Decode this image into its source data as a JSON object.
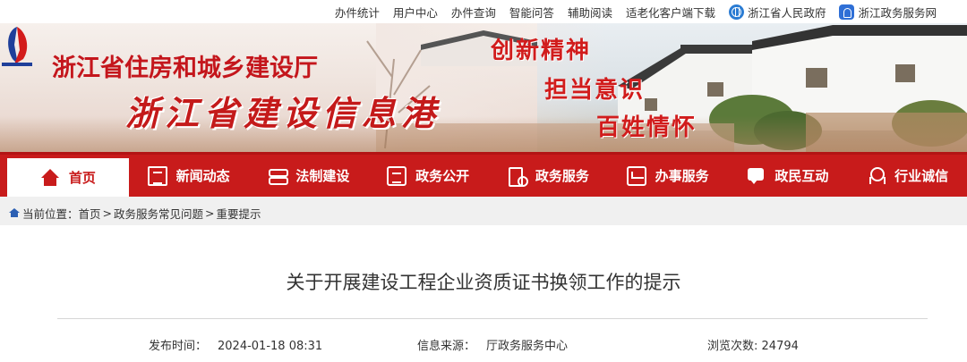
{
  "top_links": [
    "办件统计",
    "用户中心",
    "办件查询",
    "智能问答",
    "辅助阅读",
    "适老化客户端下载"
  ],
  "gov_links": {
    "province": "浙江省人民政府",
    "service": "浙江政务服务网"
  },
  "banner": {
    "dept_name": "浙江省住房和城乡建设厅",
    "port_name": "浙江省建设信息港",
    "slogans": [
      "创新精神",
      "担当意识",
      "百姓情怀"
    ],
    "logo_icon": "department-logo",
    "accent_color": "#c81b1b"
  },
  "nav": {
    "items": [
      {
        "label": "首页",
        "icon": "home-icon"
      },
      {
        "label": "新闻动态",
        "icon": "news-icon"
      },
      {
        "label": "法制建设",
        "icon": "law-icon"
      },
      {
        "label": "政务公开",
        "icon": "open-affairs-icon"
      },
      {
        "label": "政务服务",
        "icon": "service-icon"
      },
      {
        "label": "办事服务",
        "icon": "affairs-icon"
      },
      {
        "label": "政民互动",
        "icon": "interaction-icon"
      },
      {
        "label": "行业诚信",
        "icon": "credit-icon"
      }
    ],
    "active_index": 0
  },
  "breadcrumb": {
    "prefix": "当前位置：",
    "items": [
      "首页",
      "政务服务常见问题",
      "重要提示"
    ]
  },
  "article": {
    "title": "关于开展建设工程企业资质证书换领工作的提示",
    "publish_label": "发布时间：",
    "publish_time": "2024-01-18 08:31",
    "source_label": "信息来源：",
    "source": "厅政务服务中心",
    "views_label": "浏览次数:",
    "views": "24794"
  }
}
